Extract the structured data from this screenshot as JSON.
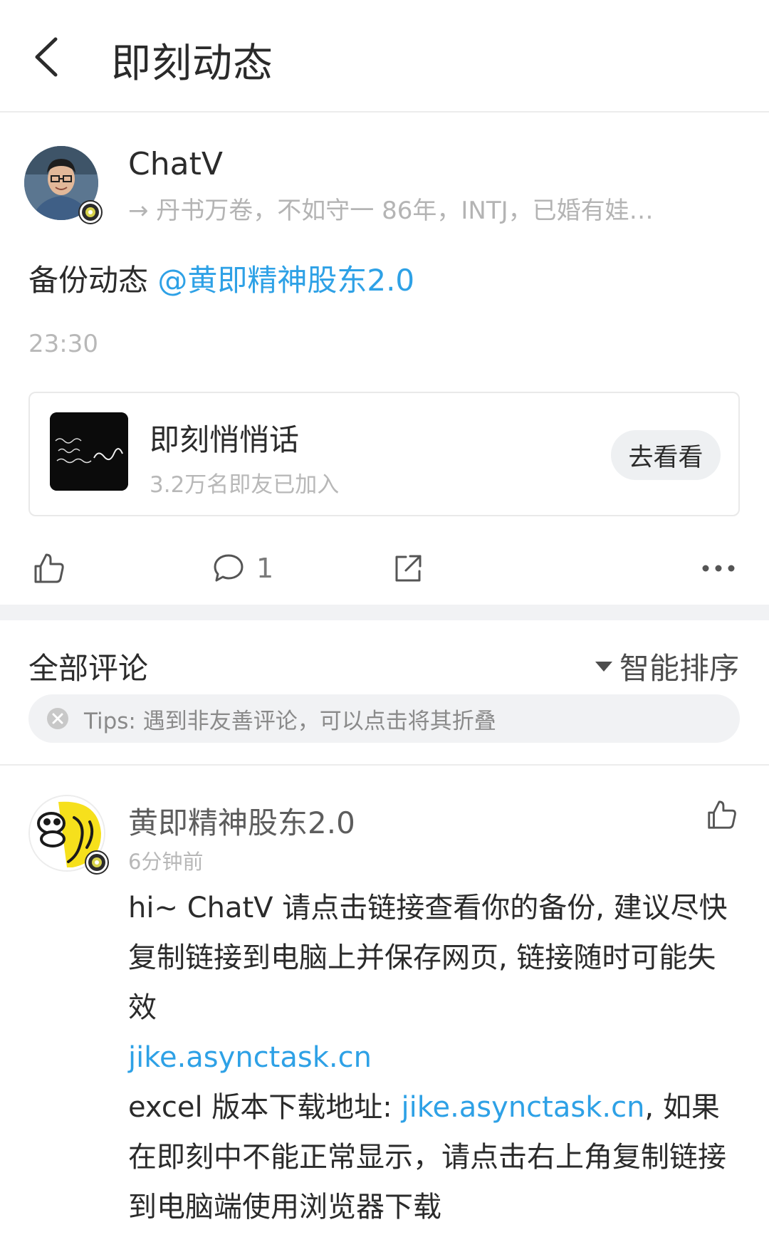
{
  "header": {
    "title": "即刻动态"
  },
  "author": {
    "name": "ChatV",
    "bio": "→ 丹书万卷，不如守一  86年，INTJ，已婚有娃…"
  },
  "post": {
    "text": "备份动态 ",
    "mention": "@黄即精神股东2.0",
    "time": "23:30"
  },
  "topic": {
    "name": "即刻悄悄话",
    "subtitle": "3.2万名即友已加入",
    "button": "去看看"
  },
  "actions": {
    "comment_count": "1"
  },
  "comments_section": {
    "title": "全部评论",
    "sort_label": "智能排序",
    "tips": "Tips: 遇到非友善评论，可以点击将其折叠"
  },
  "comment": {
    "author": "黄即精神股东2.0",
    "time": "6分钟前",
    "body_p1": "hi~ ChatV 请点击链接查看你的备份, 建议尽快复制链接到电脑上并保存网页, 链接随时可能失效",
    "link1": "jike.asynctask.cn",
    "body_p2_prefix": "excel 版本下载地址: ",
    "link2": "jike.asynctask.cn",
    "body_p2_suffix": ", 如果在即刻中不能正常显示，请点击右上角复制链接到电脑端使用浏览器下载"
  },
  "colors": {
    "link": "#2ea1e6",
    "badge": "#d7d24a"
  },
  "icons": {
    "back": "chevron-left-icon",
    "like": "thumbs-up-icon",
    "comment": "speech-bubble-icon",
    "share": "share-icon",
    "more": "more-horizontal-icon",
    "tips_close": "close-circle-icon"
  }
}
